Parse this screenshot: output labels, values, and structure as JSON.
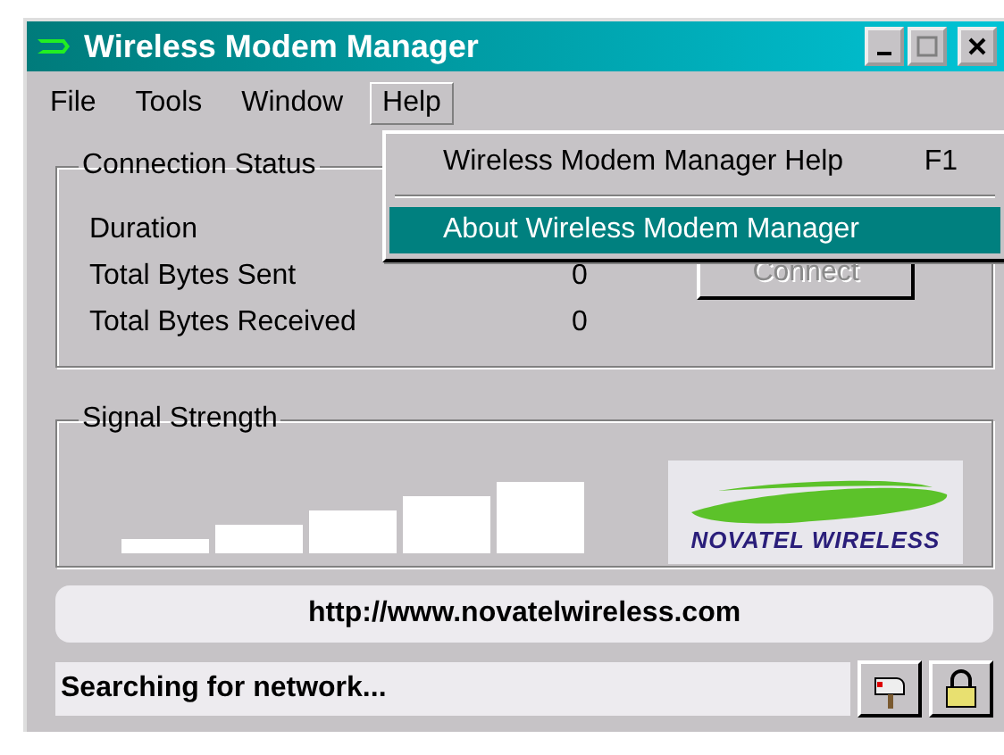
{
  "window": {
    "title": "Wireless Modem Manager"
  },
  "menu_bar": [
    {
      "label": "File",
      "selected": false
    },
    {
      "label": "Tools",
      "selected": false
    },
    {
      "label": "Window",
      "selected": false
    },
    {
      "label": "Help",
      "selected": true
    }
  ],
  "help_menu": [
    {
      "label": "Wireless Modem Manager Help",
      "shortcut": "F1",
      "selected": false
    },
    {
      "label": "About Wireless Modem Manager",
      "selected": true
    }
  ],
  "connection_status": {
    "title": "Connection Status",
    "rows": [
      {
        "label": "Duration"
      },
      {
        "label": "Total Bytes Sent",
        "value": "0"
      },
      {
        "label": "Total Bytes Received",
        "value": "0"
      }
    ],
    "connect_button": {
      "label": "Connect",
      "disabled": true
    }
  },
  "signal_strength": {
    "title": "Signal Strength",
    "logo_text": "NOVATEL WIRELESS"
  },
  "url": "http://www.novatelwireless.com",
  "status_bar": {
    "text": "Searching for network..."
  }
}
